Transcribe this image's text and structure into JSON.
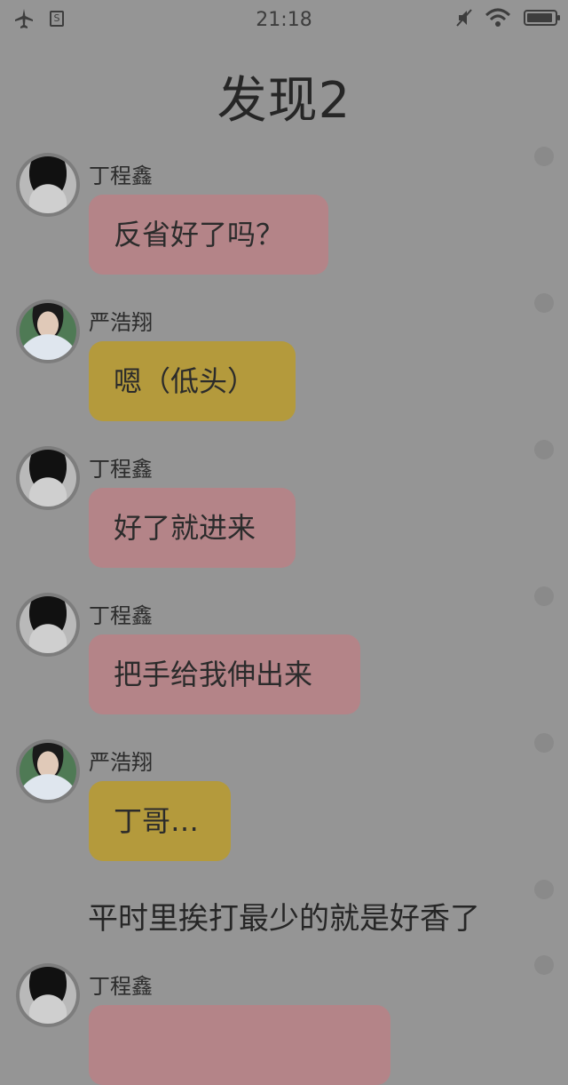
{
  "status_bar": {
    "time": "21:18",
    "left_icons": [
      "airplane-icon",
      "sim-card-icon"
    ],
    "right_icons": [
      "muted-icon",
      "wifi-icon",
      "battery-icon"
    ],
    "sim_glyph": "S"
  },
  "header": {
    "title": "发现2"
  },
  "messages": [
    {
      "type": "chat",
      "sender": "丁程鑫",
      "text": "反省好了吗？",
      "bubble_color": "#b48488"
    },
    {
      "type": "chat",
      "sender": "严浩翔",
      "text": "嗯（低头）",
      "bubble_color": "#b49a3c"
    },
    {
      "type": "chat",
      "sender": "丁程鑫",
      "text": "好了就进来",
      "bubble_color": "#b48488"
    },
    {
      "type": "chat",
      "sender": "丁程鑫",
      "text": "把手给我伸出来",
      "bubble_color": "#b48488"
    },
    {
      "type": "chat",
      "sender": "严浩翔",
      "text": "丁哥…",
      "bubble_color": "#b49a3c"
    },
    {
      "type": "narration",
      "text": "平时里挨打最少的就是好香了"
    },
    {
      "type": "chat",
      "sender": "丁程鑫",
      "text": "",
      "bubble_color": "#b48488"
    }
  ]
}
